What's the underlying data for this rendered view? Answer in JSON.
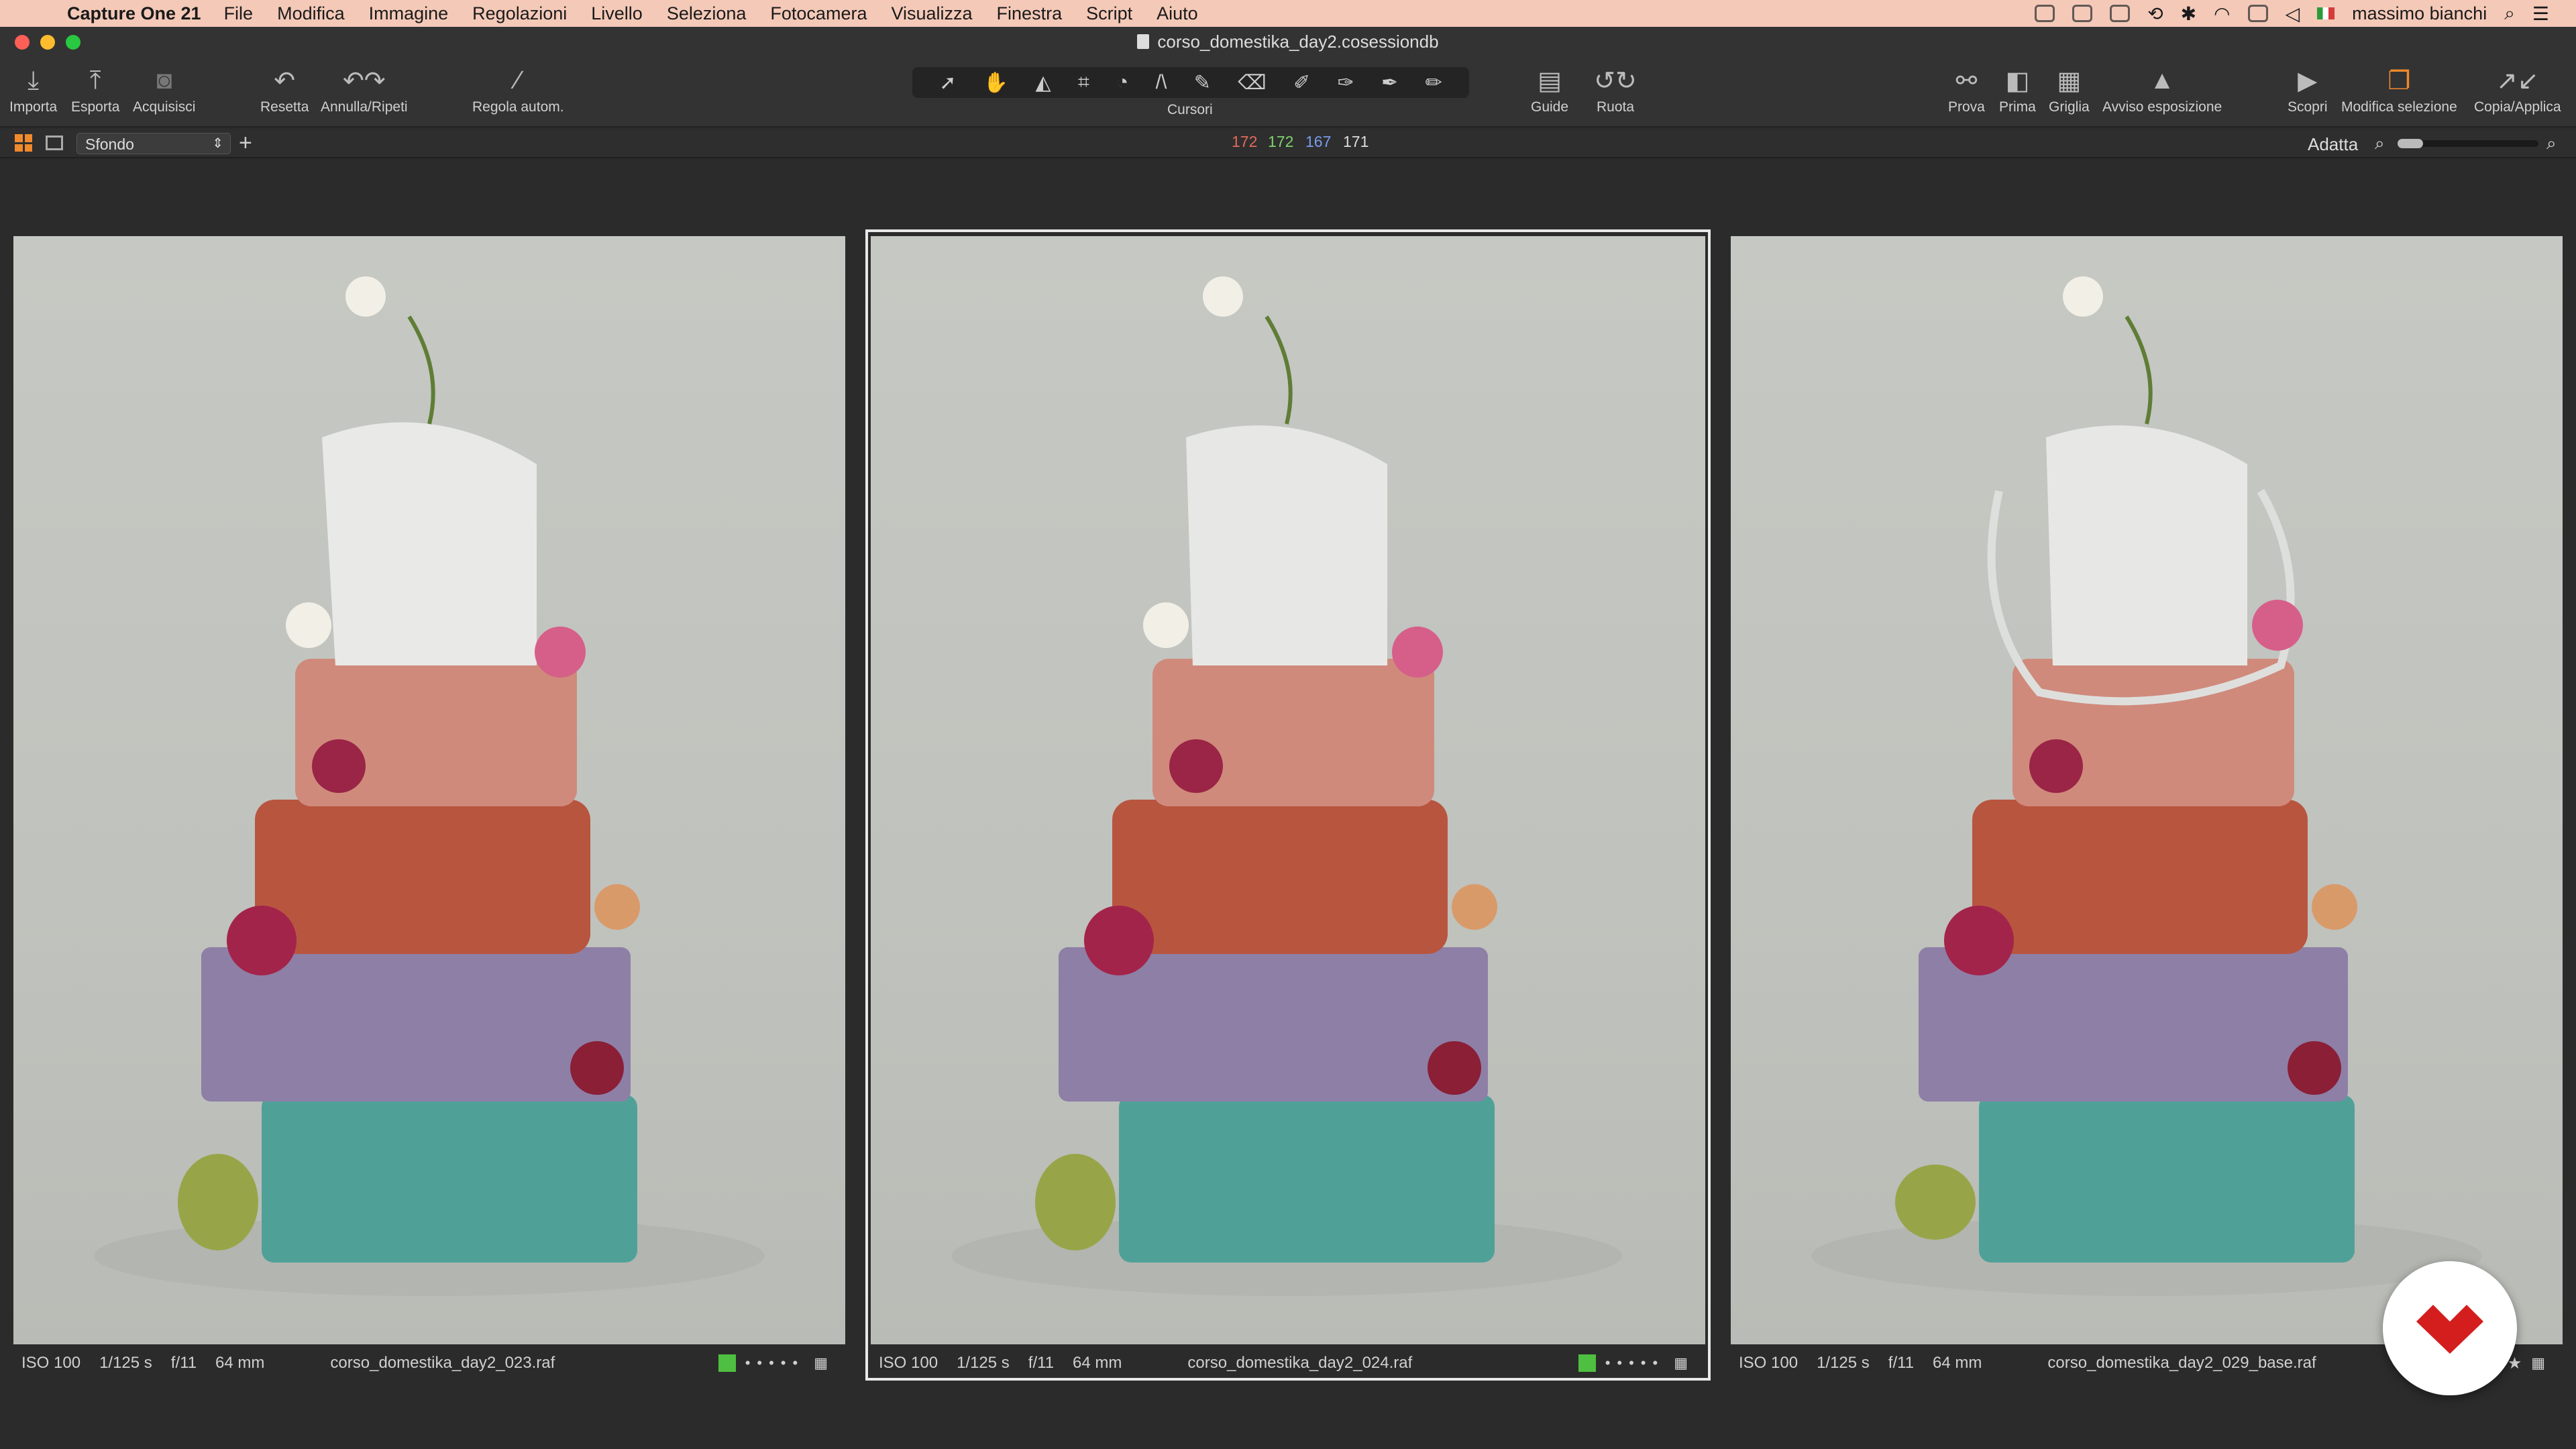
{
  "menubar": {
    "app_name": "Capture One 21",
    "items": [
      "File",
      "Modifica",
      "Immagine",
      "Regolazioni",
      "Livello",
      "Seleziona",
      "Fotocamera",
      "Visualizza",
      "Finestra",
      "Script",
      "Aiuto"
    ],
    "user": "massimo bianchi"
  },
  "window": {
    "title": "corso_domestika_day2.cosessiondb"
  },
  "toolbar": {
    "importa": "Importa",
    "esporta": "Esporta",
    "acquisisci": "Acquisisci",
    "resetta": "Resetta",
    "annulla_ripeti": "Annulla/Ripeti",
    "regola_autom": "Regola autom.",
    "cursori": "Cursori",
    "guide": "Guide",
    "ruota": "Ruota",
    "prova": "Prova",
    "prima": "Prima",
    "griglia": "Griglia",
    "avviso": "Avviso esposizione",
    "scopri": "Scopri",
    "modifica_selezione": "Modifica selezione",
    "copia_applica": "Copia/Applica"
  },
  "subbar": {
    "layer": "Sfondo",
    "rgb": {
      "r": "172",
      "g": "172",
      "b": "167",
      "l": "171"
    },
    "zoom": "Adatta"
  },
  "photos": [
    {
      "iso": "ISO 100",
      "shutter": "1/125 s",
      "aperture": "f/11",
      "focal": "64 mm",
      "filename": "corso_domestika_day2_023.raf",
      "color_tag": "#4fbf41"
    },
    {
      "iso": "ISO 100",
      "shutter": "1/125 s",
      "aperture": "f/11",
      "focal": "64 mm",
      "filename": "corso_domestika_day2_024.raf",
      "color_tag": "#4fbf41"
    },
    {
      "iso": "ISO 100",
      "shutter": "1/125 s",
      "aperture": "f/11",
      "focal": "64 mm",
      "filename": "corso_domestika_day2_029_base.raf",
      "color_tag": ""
    }
  ],
  "colors": {
    "accent": "#f08a2c",
    "red": "#e26a5a",
    "green": "#7ed36b",
    "blue": "#7a9cf0"
  }
}
